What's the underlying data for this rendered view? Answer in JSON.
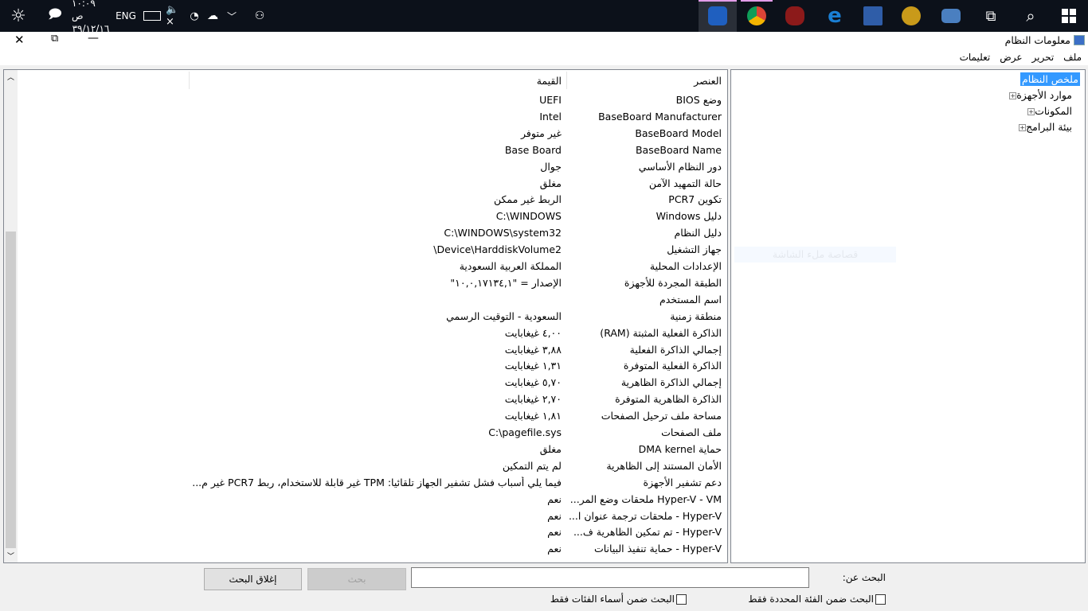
{
  "taskbar": {
    "time": "١٠:٠٩ ص",
    "date": "٣٩/١٢/١٦",
    "language": "ENG",
    "icons": [
      "brightness-icon",
      "action-center-icon",
      "keyboard-icon",
      "volume-muted-icon",
      "wifi-icon",
      "onedrive-icon",
      "chevron-down-icon",
      "people-icon"
    ],
    "apps": [
      {
        "name": "system-information-app",
        "color": "#1f5fbf"
      },
      {
        "name": "chrome-app",
        "color": "#e8b400"
      },
      {
        "name": "media-player-app",
        "color": "#8c1a1a"
      },
      {
        "name": "edge-app",
        "color": "#1a7fd4"
      },
      {
        "name": "remote-app",
        "color": "#2f5da8"
      },
      {
        "name": "gold-app",
        "color": "#c99a1a"
      },
      {
        "name": "chat-app",
        "color": "#4a7fc0"
      },
      {
        "name": "task-view",
        "color": "#ffffff"
      },
      {
        "name": "search",
        "color": "#ffffff"
      },
      {
        "name": "start",
        "color": "#ffffff"
      }
    ]
  },
  "window": {
    "title": "معلومات النظام"
  },
  "menu": [
    "ملف",
    "تحرير",
    "عرض",
    "تعليمات"
  ],
  "tree": {
    "selected": "ملخص النظام",
    "items": [
      "موارد الأجهزة",
      "المكونات",
      "بيئة البرامج"
    ]
  },
  "overlay_text": "قصاصة ملء الشاشة",
  "table": {
    "headers": {
      "item": "العنصر",
      "value": "القيمة"
    },
    "rows": [
      [
        "وضع BIOS",
        "UEFI"
      ],
      [
        "BaseBoard Manufacturer",
        "Intel"
      ],
      [
        "BaseBoard Model",
        "غير متوفر"
      ],
      [
        "BaseBoard Name",
        "Base Board"
      ],
      [
        "دور النظام الأساسي",
        "جوال"
      ],
      [
        "حالة التمهيد الآمن",
        "مغلق"
      ],
      [
        "تكوين PCR7",
        "الربط غير ممكن"
      ],
      [
        "دليل Windows",
        "C:\\WINDOWS"
      ],
      [
        "دليل النظام",
        "C:\\WINDOWS\\system32"
      ],
      [
        "جهاز التشغيل",
        "Device\\HarddiskVolume2\\"
      ],
      [
        "الإعدادات المحلية",
        "المملكة العربية السعودية"
      ],
      [
        "الطبقة المجردة للأجهزة",
        "الإصدار = \"١٠,٠,١٧١٣٤,١\""
      ],
      [
        "اسم المستخدم",
        ""
      ],
      [
        "منطقة زمنية",
        "السعودية - التوقيت الرسمي"
      ],
      [
        "الذاكرة الفعلية المثبتة (RAM)",
        "٤,٠٠ غيغابايت"
      ],
      [
        "إجمالي الذاكرة الفعلية",
        "٣,٨٨ غيغابايت"
      ],
      [
        "الذاكرة الفعلية المتوفرة",
        "١,٣١ غيغابايت"
      ],
      [
        "إجمالي الذاكرة الظاهرية",
        "٥,٧٠ غيغابايت"
      ],
      [
        "الذاكرة الظاهرية المتوفرة",
        "٢,٧٠ غيغابايت"
      ],
      [
        "مساحة ملف ترحيل الصفحات",
        "١,٨١ غيغابايت"
      ],
      [
        "ملف الصفحات",
        "C:\\pagefile.sys"
      ],
      [
        "حماية DMA kernel",
        "مغلق"
      ],
      [
        "الأمان المستند إلى الظاهرية",
        "لم يتم التمكين"
      ],
      [
        "دعم تشفير الأجهزة",
        "فيما يلي أسباب فشل تشفير الجهاز تلقائيا: TPM غير قابلة للاستخدام، ربط PCR7 غير م..."
      ],
      [
        "Hyper-V - VM ملحقات وضع المر...",
        "نعم"
      ],
      [
        "Hyper-V - ملحقات ترجمة عنوان ا...",
        "نعم"
      ],
      [
        "Hyper-V  - تم تمكين الظاهرية ف...",
        "نعم"
      ],
      [
        "Hyper-V - حماية تنفيذ البيانات",
        "نعم"
      ]
    ]
  },
  "search": {
    "label": "البحث عن:",
    "value": "",
    "find_button": "بحث",
    "close_button": "إغلاق البحث",
    "check_selected": "البحث ضمن الفئة المحددة فقط",
    "check_names": "البحث ضمن أسماء الفئات فقط"
  }
}
